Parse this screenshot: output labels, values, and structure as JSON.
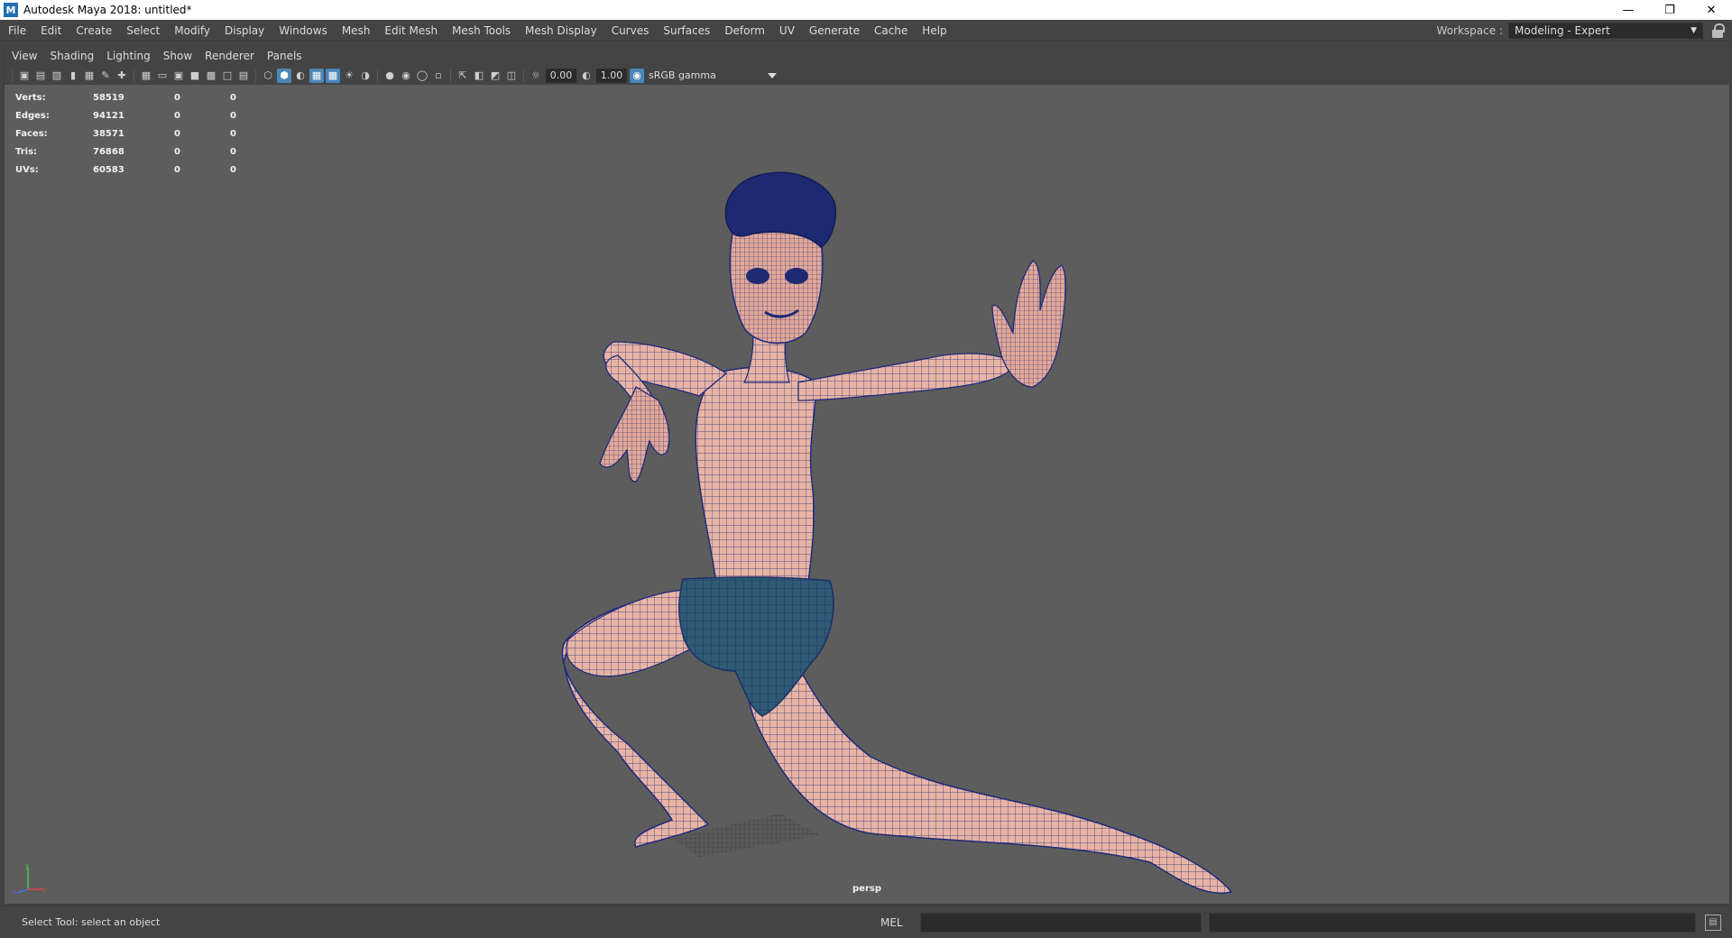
{
  "window": {
    "title": "Autodesk Maya 2018: untitled*",
    "app_icon": "M",
    "controls": [
      "minimize-icon",
      "restore-icon",
      "close-icon"
    ]
  },
  "menubar": {
    "items": [
      "File",
      "Edit",
      "Create",
      "Select",
      "Modify",
      "Display",
      "Windows",
      "Mesh",
      "Edit Mesh",
      "Mesh Tools",
      "Mesh Display",
      "Curves",
      "Surfaces",
      "Deform",
      "UV",
      "Generate",
      "Cache",
      "Help"
    ]
  },
  "workspace": {
    "label": "Workspace :",
    "value": "Modeling - Expert"
  },
  "panel_menu": {
    "items": [
      "View",
      "Shading",
      "Lighting",
      "Show",
      "Renderer",
      "Panels"
    ]
  },
  "toolbar": {
    "exposure": "0.00",
    "gamma": "1.00",
    "color_space": "sRGB gamma"
  },
  "hud": {
    "rows": [
      {
        "label": "Verts:",
        "value": "58519",
        "c1": "0",
        "c2": "0"
      },
      {
        "label": "Edges:",
        "value": "94121",
        "c1": "0",
        "c2": "0"
      },
      {
        "label": "Faces:",
        "value": "38571",
        "c1": "0",
        "c2": "0"
      },
      {
        "label": "Tris:",
        "value": "76868",
        "c1": "0",
        "c2": "0"
      },
      {
        "label": "UVs:",
        "value": "60583",
        "c1": "0",
        "c2": "0"
      }
    ]
  },
  "viewport": {
    "camera": "persp",
    "axis_labels": {
      "x": "x",
      "y": "y",
      "z": "z"
    },
    "colors": {
      "skin": "#e8b4a4",
      "wire": "#1f2a7a",
      "shorts": "#2f5a73",
      "hair": "#1d2a72",
      "background": "#5d5d5d"
    }
  },
  "statusbar": {
    "help_line": "Select Tool: select an object",
    "language": "MEL"
  }
}
